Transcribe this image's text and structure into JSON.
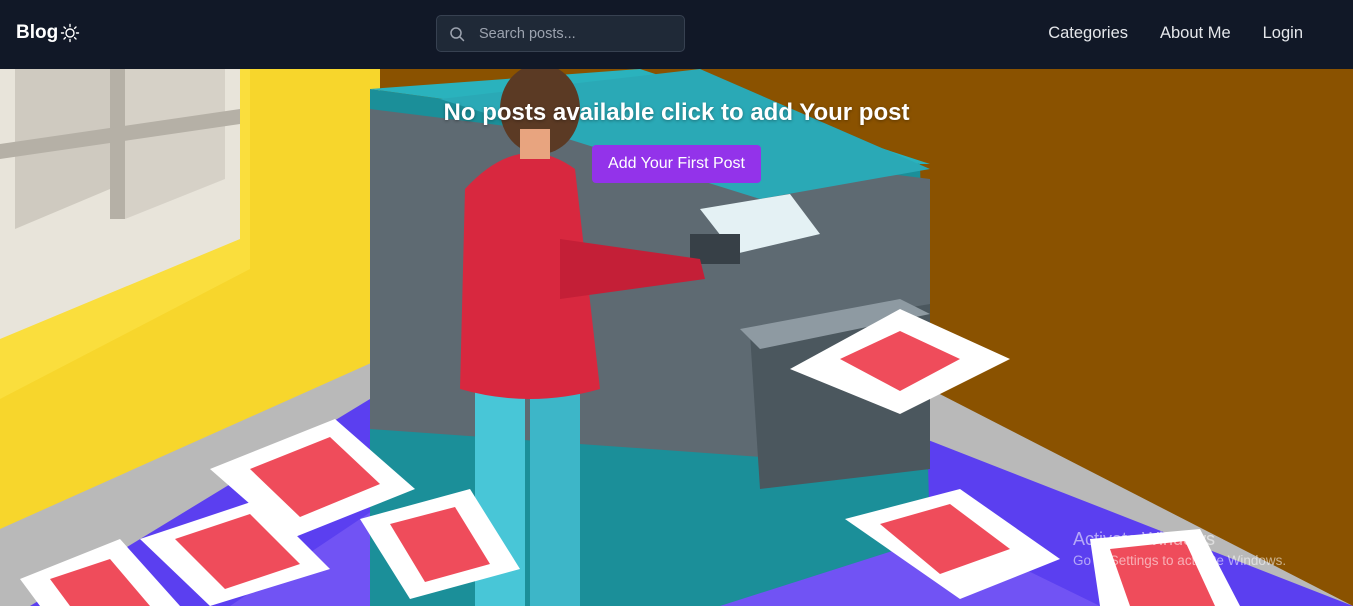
{
  "nav": {
    "logo_text": "Blog",
    "search_placeholder": "Search posts...",
    "links": [
      "Categories",
      "About Me",
      "Login"
    ]
  },
  "hero": {
    "title": "No posts available click to add Your post",
    "button_label": "Add Your First Post"
  },
  "watermark": {
    "title": "Activate Windows",
    "subtitle": "Go to Settings to activate Windows."
  },
  "colors": {
    "navbar_bg": "#111827",
    "accent_button": "#9333ea",
    "wall_brown": "#8a5200",
    "wall_yellow": "#f7d62c",
    "floor_purple": "#5b3ff0",
    "printer_teal": "#1b8f99"
  },
  "icons": {
    "logo": "sun-icon",
    "search": "search-icon"
  }
}
